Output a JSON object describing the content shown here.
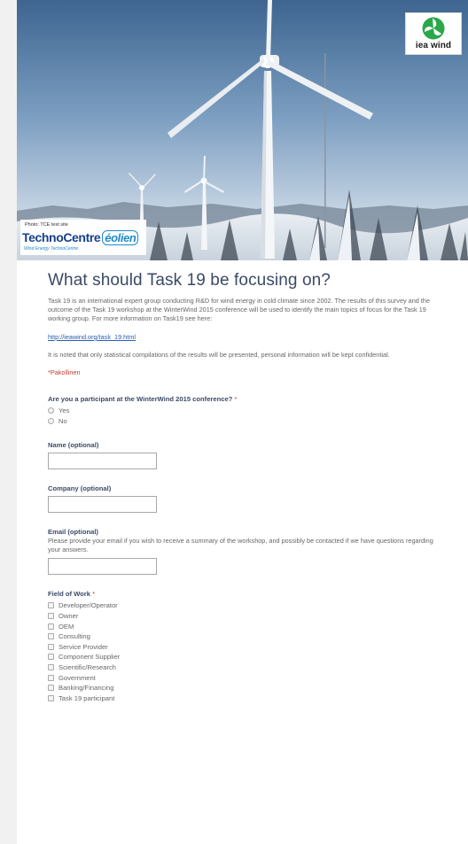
{
  "banner": {
    "logo_text": "iea wind",
    "photo_credit": "Photo: TCE test site",
    "brand_main": "TechnoCentre",
    "brand_eolien": "éolien",
    "brand_sub": "Wind Energy TechnoCentre"
  },
  "form": {
    "title": "What should Task 19 be focusing on?",
    "description": "Task 19 is an international expert group conducting R&D for wind energy in cold climate since 2002. The results of this survey and the outcome of the Task 19 workshop at the WinterWind 2015 conference will be used to identify the main topics of focus for the Task 19 working group. For more information on Task19 see here:",
    "link": "http://ieawind.org/task_19.html",
    "note": "It is noted that only statistical compilations of the results will be presented, personal information will be kept confidential.",
    "required_note": "*Pakollinen"
  },
  "questions": {
    "participant": {
      "label": "Are you a participant at the WinterWind 2015 conference?",
      "star": "*",
      "options": [
        "Yes",
        "No"
      ]
    },
    "name": {
      "label": "Name (optional)",
      "value": ""
    },
    "company": {
      "label": "Company (optional)",
      "value": ""
    },
    "email": {
      "label": "Email (optional)",
      "help": "Please provide your email if you wish to receive a summary of the workshop, and possibly be contacted if we have questions regarding your answers.",
      "value": ""
    },
    "field": {
      "label": "Field of Work",
      "star": "*",
      "options": [
        "Developer/Operator",
        "Owner",
        "OEM",
        "Consulting",
        "Service Provider",
        "Component Supplier",
        "Scientific/Research",
        "Government",
        "Banking/Financing",
        "Task 19 participant"
      ]
    }
  },
  "colors": {
    "title": "#3a4a66",
    "required": "#c43b2f",
    "link": "#2a5db0",
    "brand": "#17408b",
    "accent_green": "#2aa84a"
  }
}
